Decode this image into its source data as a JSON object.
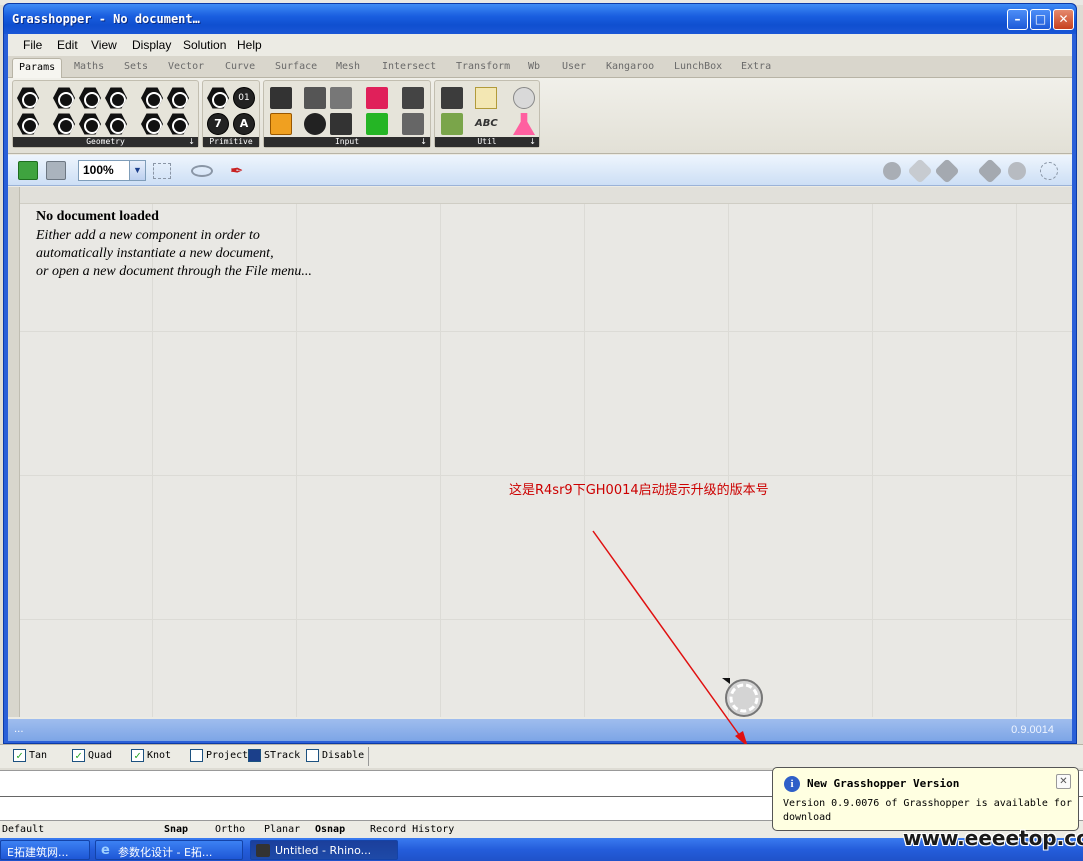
{
  "window": {
    "title": "Grasshopper - No document…",
    "min": "–",
    "max": "□",
    "close": "✕"
  },
  "menu": [
    "File",
    "Edit",
    "View",
    "Display",
    "Solution",
    "Help"
  ],
  "tabs": [
    "Params",
    "Maths",
    "Sets",
    "Vector",
    "Curve",
    "Surface",
    "Mesh",
    "Intersect",
    "Transform",
    "Wb",
    "User",
    "Kangaroo",
    "LunchBox",
    "Extra"
  ],
  "ribbon": {
    "panels": [
      "Geometry",
      "Primitive",
      "Input",
      "Util"
    ],
    "primitive_glyphs": [
      "0",
      "01",
      "7",
      "A"
    ],
    "util_glyph": "ABC"
  },
  "toolbar": {
    "zoom": "100%"
  },
  "canvas": {
    "message_title": "No document loaded",
    "message_lines": [
      "Either add a new component in order to",
      "automatically instantiate a new document,",
      "or open a new document through the File menu..."
    ],
    "annotation": "这是R4sr9下GH0014启动提示升级的版本号"
  },
  "status": {
    "ellipsis": "...",
    "version": "0.9.0014"
  },
  "osnap": [
    {
      "label": "Tan",
      "checked": true
    },
    {
      "label": "Quad",
      "checked": true
    },
    {
      "label": "Knot",
      "checked": true
    },
    {
      "label": "Project",
      "checked": false
    },
    {
      "label": "STrack",
      "checked": false
    },
    {
      "label": "Disable",
      "checked": false
    }
  ],
  "rhino_status": {
    "layer": "Default",
    "snap": "Snap",
    "ortho": "Ortho",
    "planar": "Planar",
    "osnap": "Osnap",
    "record_history": "Record History"
  },
  "taskbar": [
    "E拓建筑网...",
    "参数化设计 - E拓...",
    "Untitled - Rhino..."
  ],
  "balloon": {
    "title": "New Grasshopper Version",
    "body": "Version 0.9.0076 of Grasshopper is available for download",
    "info": "i",
    "close": "✕"
  },
  "watermark": "www.eeeetop.com",
  "colors": {
    "annotation": "#cc0000",
    "arrow": "#e01010",
    "titlebar": "#1a5fe0"
  }
}
